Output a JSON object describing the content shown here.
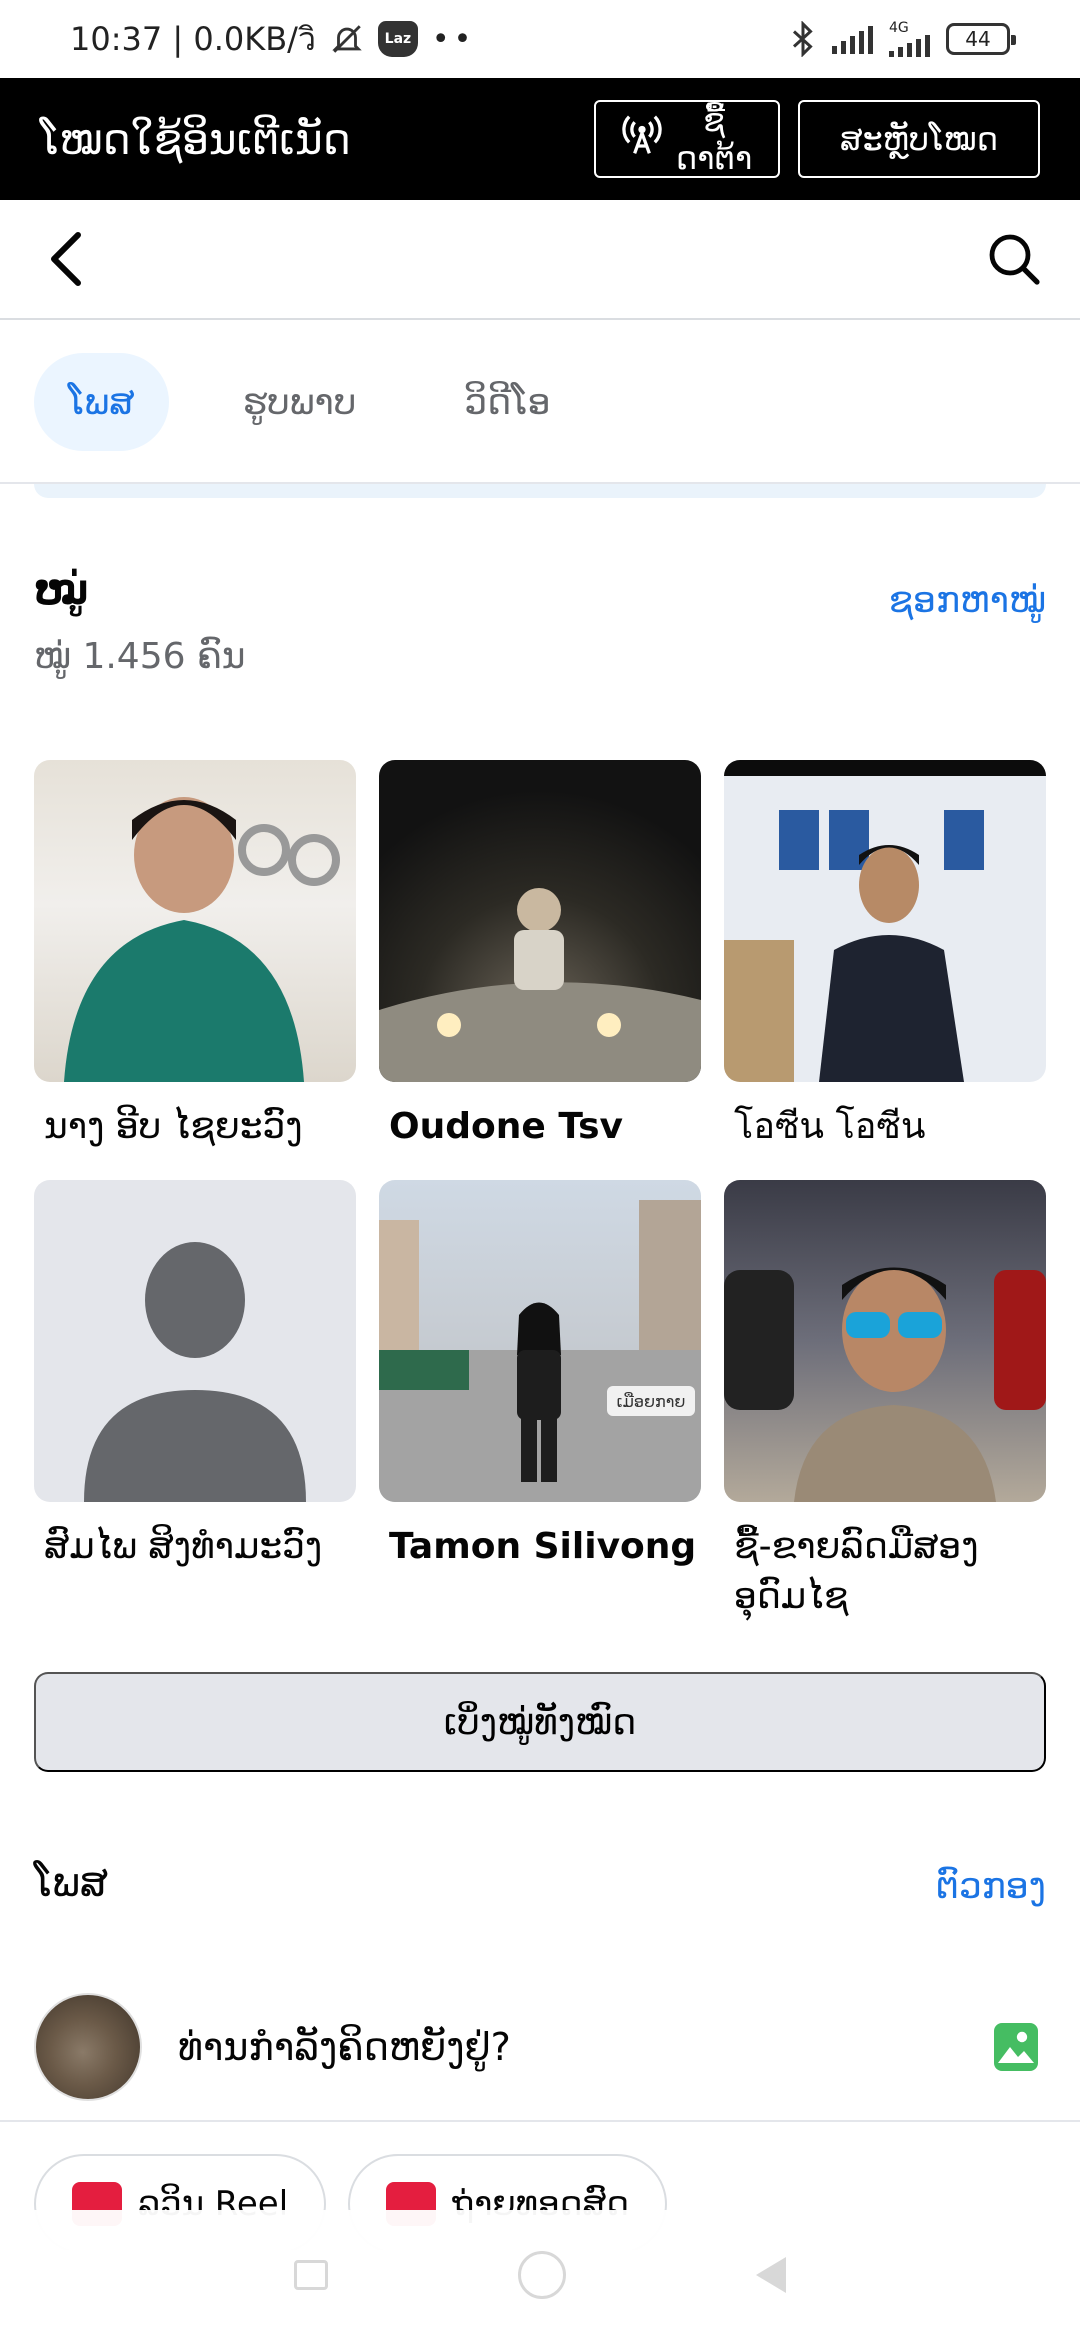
{
  "status_bar": {
    "time_speed": "10:37 | 0.0KB/วิ",
    "laz_label": "Laz",
    "network": "4G",
    "battery": "44"
  },
  "data_mode": {
    "title": "ໂໝດໃຊ້ອິນເຕີເນັດ",
    "buy_label": "ຊື້ດາຕ້າ",
    "switch_label": "ສະຫຼັບໂໝດ"
  },
  "tabs": [
    "ໂພສ",
    "ຮູບພາບ",
    "ວິດີໂອ"
  ],
  "friends": {
    "title": "ໝູ່",
    "count": "ໝູ່ 1.456 ຄົນ",
    "find_label": "ຊອກຫາໝູ່",
    "items": [
      {
        "name": "ນາງ ອີບ ໄຊຍະວົງ"
      },
      {
        "name": "Oudone Tsv"
      },
      {
        "name": "โอซีน โอซีน"
      },
      {
        "name": "ສົມໄພ ສິງທໍາມະວົງ"
      },
      {
        "name": "Tamon Silivong"
      },
      {
        "name": "ຊື້-ຂາຍລົດມືສອງ ອຸດົມໄຊ"
      }
    ],
    "photo5_caption": "ເມືອຍກາຍ",
    "see_all_label": "ເບິ່ງໝູ່ທັງໝົດ"
  },
  "posts": {
    "title": "ໂພສ",
    "filter_label": "ຕົວກອງ",
    "composer_prompt": "ທ່ານກໍາລັງຄິດຫຍັງຢູ່?",
    "chips": [
      {
        "label": "ລວິນ Reel",
        "icon": "reel-icon"
      },
      {
        "label": "ຖ່າຍທອດສົດ",
        "icon": "live-video-icon"
      }
    ]
  },
  "colors": {
    "accent": "#1b74e4",
    "data_bar_bg": "#000000",
    "tab_active_bg": "#ebf5ff",
    "button_bg": "#e4e6eb"
  }
}
